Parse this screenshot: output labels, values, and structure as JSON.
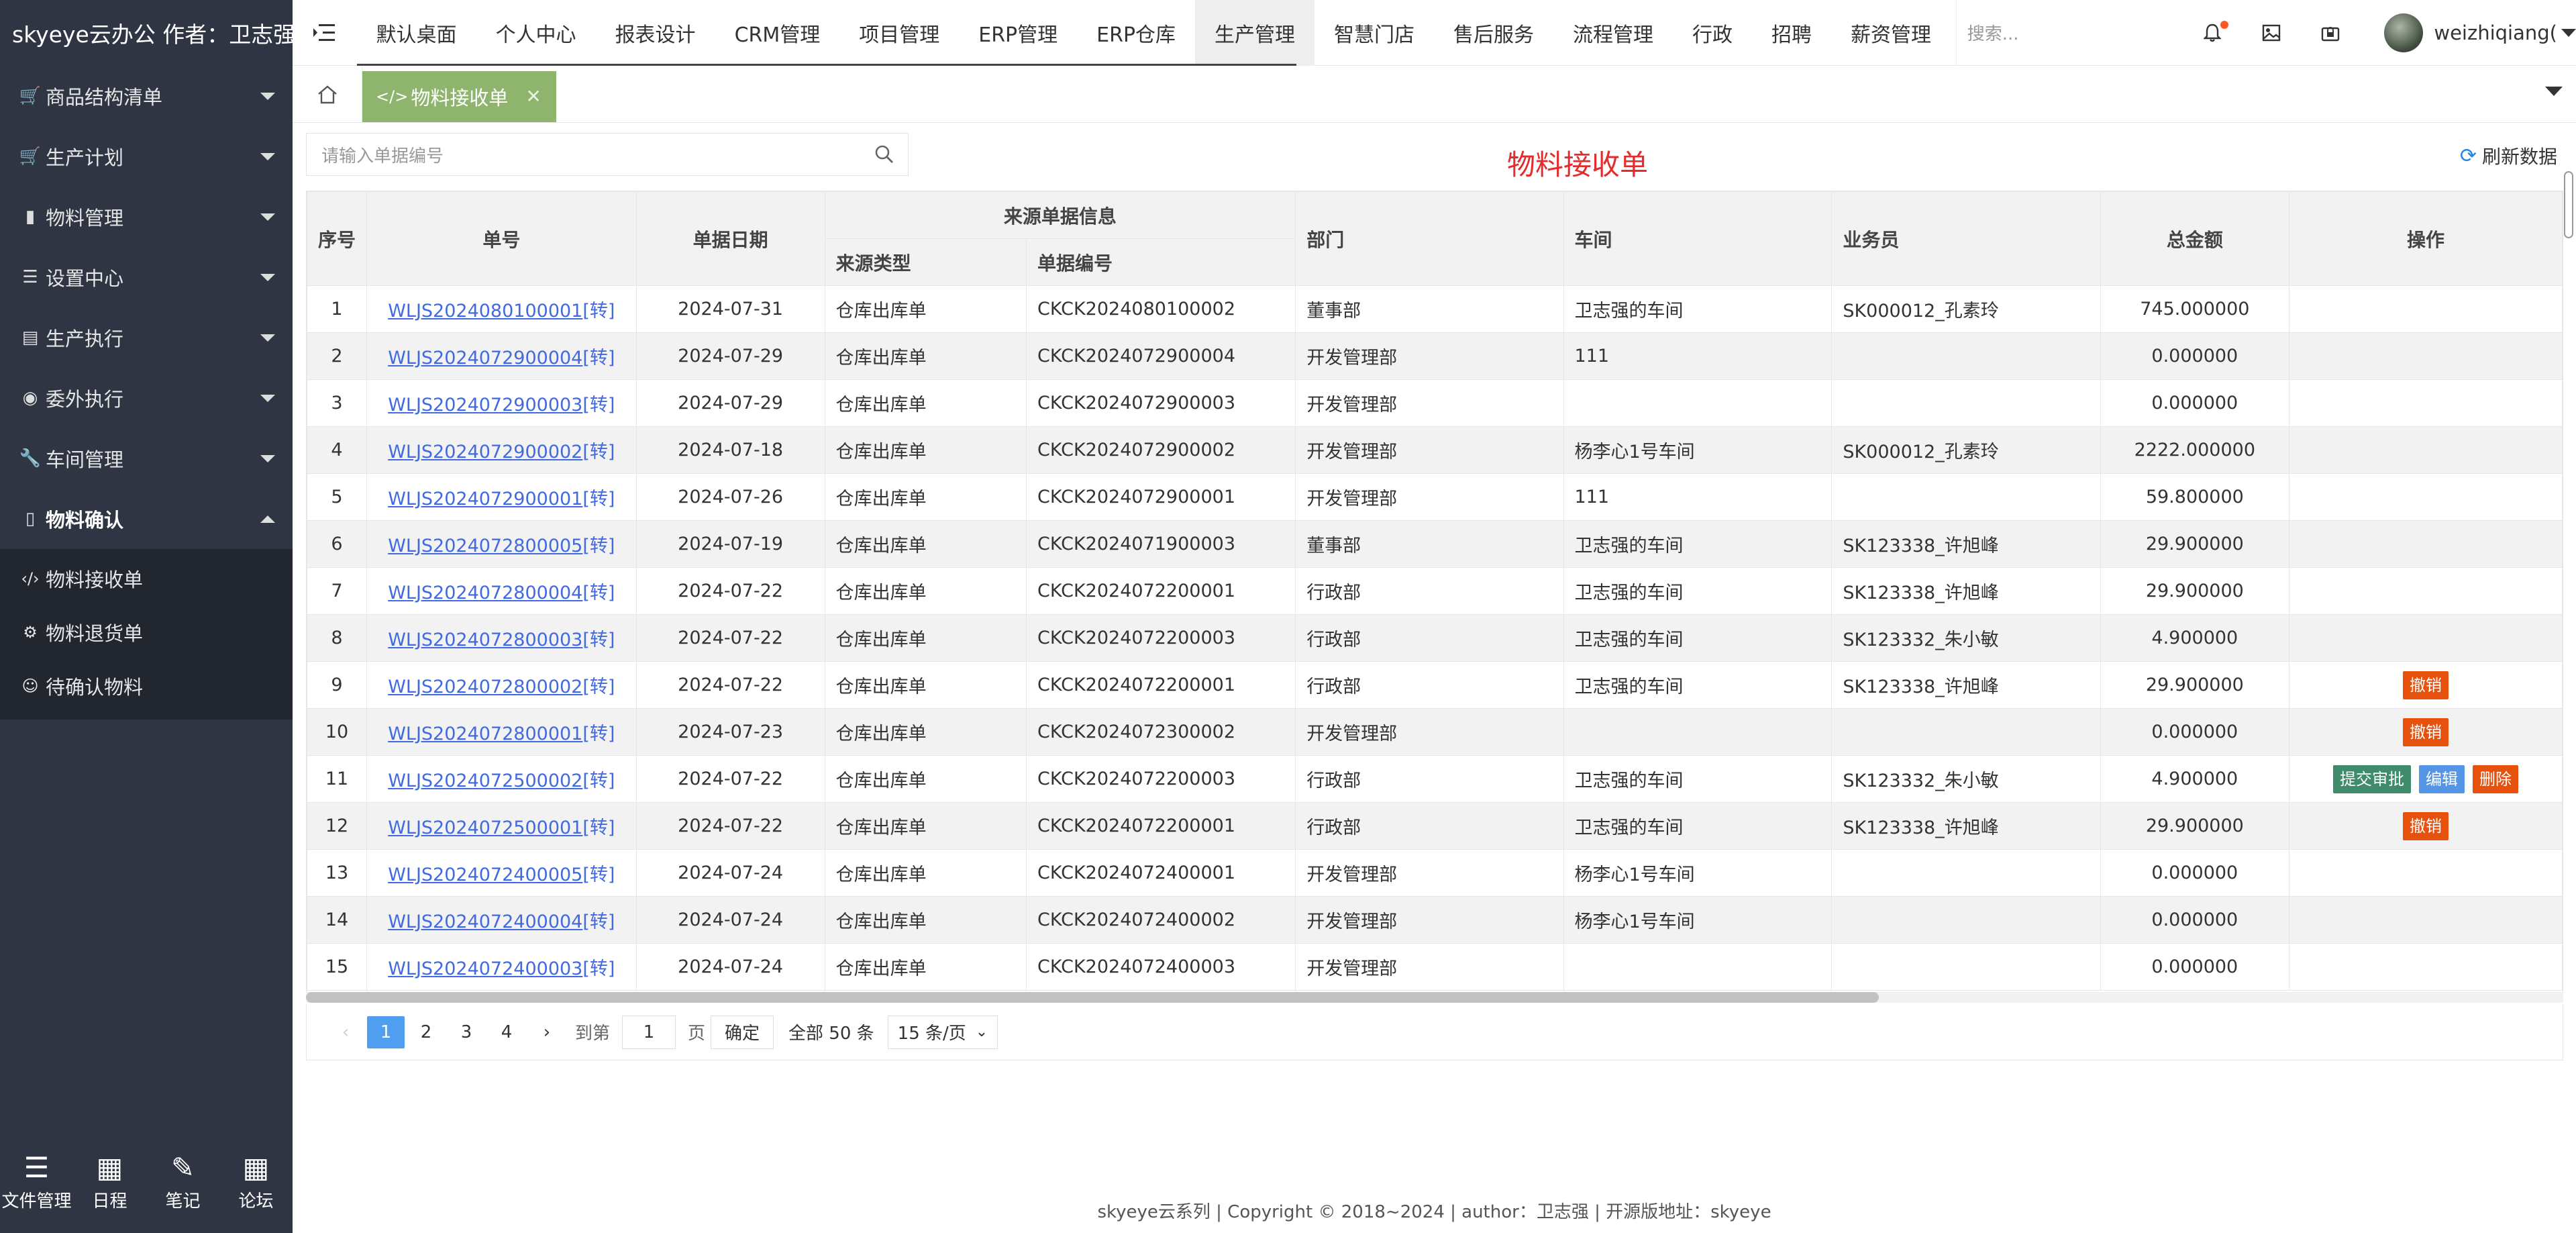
{
  "brand": "skyeye云办公 作者：卫志强",
  "sidebar": {
    "items": [
      {
        "label": "商品结构清单",
        "icon": "cart-icon"
      },
      {
        "label": "生产计划",
        "icon": "cart-icon"
      },
      {
        "label": "物料管理",
        "icon": "folder-icon"
      },
      {
        "label": "设置中心",
        "icon": "sliders-icon"
      },
      {
        "label": "生产执行",
        "icon": "trash-icon"
      },
      {
        "label": "委外执行",
        "icon": "target-icon"
      },
      {
        "label": "车间管理",
        "icon": "wrench-icon"
      },
      {
        "label": "物料确认",
        "icon": "copy-icon"
      }
    ],
    "sub_items": [
      {
        "label": "物料接收单",
        "icon": "code-icon"
      },
      {
        "label": "物料退货单",
        "icon": "gear-icon"
      },
      {
        "label": "待确认物料",
        "icon": "smile-icon"
      }
    ],
    "bottom": [
      {
        "label": "文件管理",
        "icon": "list-icon"
      },
      {
        "label": "日程",
        "icon": "calendar-icon"
      },
      {
        "label": "笔记",
        "icon": "edit-icon"
      },
      {
        "label": "论坛",
        "icon": "calendar-icon"
      }
    ]
  },
  "topnav": {
    "items": [
      "默认桌面",
      "个人中心",
      "报表设计",
      "CRM管理",
      "项目管理",
      "ERP管理",
      "ERP仓库",
      "生产管理",
      "智慧门店",
      "售后服务",
      "流程管理",
      "行政",
      "招聘",
      "薪资管理"
    ],
    "active": "生产管理",
    "search_placeholder": "搜索...",
    "username": "weizhiqiang("
  },
  "tab": {
    "label": "物料接收单"
  },
  "toolbar": {
    "search_placeholder": "请输入单据编号",
    "heading": "物料接收单",
    "refresh_label": "刷新数据"
  },
  "table": {
    "headers": {
      "seq": "序号",
      "no": "单号",
      "date": "单据日期",
      "source_group": "来源单据信息",
      "source_type": "来源类型",
      "source_no": "单据编号",
      "dept": "部门",
      "workshop": "车间",
      "salesman": "业务员",
      "total": "总金额",
      "ops": "操作"
    },
    "rows": [
      {
        "seq": "1",
        "no": "WLJS2024080100001",
        "tag": "[转]",
        "date": "2024-07-31",
        "type": "仓库出库单",
        "src": "CKCK2024080100002",
        "dept": "董事部",
        "ws": "卫志强的车间",
        "sales": "SK000012_孔素玲",
        "total": "745.000000",
        "ops": []
      },
      {
        "seq": "2",
        "no": "WLJS2024072900004",
        "tag": "[转]",
        "date": "2024-07-29",
        "type": "仓库出库单",
        "src": "CKCK2024072900004",
        "dept": "开发管理部",
        "ws": "111",
        "sales": "",
        "total": "0.000000",
        "ops": []
      },
      {
        "seq": "3",
        "no": "WLJS2024072900003",
        "tag": "[转]",
        "date": "2024-07-29",
        "type": "仓库出库单",
        "src": "CKCK2024072900003",
        "dept": "开发管理部",
        "ws": "",
        "sales": "",
        "total": "0.000000",
        "ops": []
      },
      {
        "seq": "4",
        "no": "WLJS2024072900002",
        "tag": "[转]",
        "date": "2024-07-18",
        "type": "仓库出库单",
        "src": "CKCK2024072900002",
        "dept": "开发管理部",
        "ws": "杨李心1号车间",
        "sales": "SK000012_孔素玲",
        "total": "2222.000000",
        "ops": []
      },
      {
        "seq": "5",
        "no": "WLJS2024072900001",
        "tag": "[转]",
        "date": "2024-07-26",
        "type": "仓库出库单",
        "src": "CKCK2024072900001",
        "dept": "开发管理部",
        "ws": "111",
        "sales": "",
        "total": "59.800000",
        "ops": []
      },
      {
        "seq": "6",
        "no": "WLJS2024072800005",
        "tag": "[转]",
        "date": "2024-07-19",
        "type": "仓库出库单",
        "src": "CKCK2024071900003",
        "dept": "董事部",
        "ws": "卫志强的车间",
        "sales": "SK123338_许旭峰",
        "total": "29.900000",
        "ops": []
      },
      {
        "seq": "7",
        "no": "WLJS2024072800004",
        "tag": "[转]",
        "date": "2024-07-22",
        "type": "仓库出库单",
        "src": "CKCK2024072200001",
        "dept": "行政部",
        "ws": "卫志强的车间",
        "sales": "SK123338_许旭峰",
        "total": "29.900000",
        "ops": []
      },
      {
        "seq": "8",
        "no": "WLJS2024072800003",
        "tag": "[转]",
        "date": "2024-07-22",
        "type": "仓库出库单",
        "src": "CKCK2024072200003",
        "dept": "行政部",
        "ws": "卫志强的车间",
        "sales": "SK123332_朱小敏",
        "total": "4.900000",
        "ops": []
      },
      {
        "seq": "9",
        "no": "WLJS2024072800002",
        "tag": "[转]",
        "date": "2024-07-22",
        "type": "仓库出库单",
        "src": "CKCK2024072200001",
        "dept": "行政部",
        "ws": "卫志强的车间",
        "sales": "SK123338_许旭峰",
        "total": "29.900000",
        "ops": [
          {
            "label": "撤销",
            "color": "red"
          }
        ]
      },
      {
        "seq": "10",
        "no": "WLJS2024072800001",
        "tag": "[转]",
        "date": "2024-07-23",
        "type": "仓库出库单",
        "src": "CKCK2024072300002",
        "dept": "开发管理部",
        "ws": "",
        "sales": "",
        "total": "0.000000",
        "ops": [
          {
            "label": "撤销",
            "color": "red"
          }
        ]
      },
      {
        "seq": "11",
        "no": "WLJS2024072500002",
        "tag": "[转]",
        "date": "2024-07-22",
        "type": "仓库出库单",
        "src": "CKCK2024072200003",
        "dept": "行政部",
        "ws": "卫志强的车间",
        "sales": "SK123332_朱小敏",
        "total": "4.900000",
        "ops": [
          {
            "label": "提交审批",
            "color": "green"
          },
          {
            "label": "编辑",
            "color": "blue"
          },
          {
            "label": "删除",
            "color": "red"
          }
        ]
      },
      {
        "seq": "12",
        "no": "WLJS2024072500001",
        "tag": "[转]",
        "date": "2024-07-22",
        "type": "仓库出库单",
        "src": "CKCK2024072200001",
        "dept": "行政部",
        "ws": "卫志强的车间",
        "sales": "SK123338_许旭峰",
        "total": "29.900000",
        "ops": [
          {
            "label": "撤销",
            "color": "red"
          }
        ]
      },
      {
        "seq": "13",
        "no": "WLJS2024072400005",
        "tag": "[转]",
        "date": "2024-07-24",
        "type": "仓库出库单",
        "src": "CKCK2024072400001",
        "dept": "开发管理部",
        "ws": "杨李心1号车间",
        "sales": "",
        "total": "0.000000",
        "ops": []
      },
      {
        "seq": "14",
        "no": "WLJS2024072400004",
        "tag": "[转]",
        "date": "2024-07-24",
        "type": "仓库出库单",
        "src": "CKCK2024072400002",
        "dept": "开发管理部",
        "ws": "杨李心1号车间",
        "sales": "",
        "total": "0.000000",
        "ops": []
      },
      {
        "seq": "15",
        "no": "WLJS2024072400003",
        "tag": "[转]",
        "date": "2024-07-24",
        "type": "仓库出库单",
        "src": "CKCK2024072400003",
        "dept": "开发管理部",
        "ws": "",
        "sales": "",
        "total": "0.000000",
        "ops": []
      }
    ]
  },
  "pager": {
    "pages": [
      "1",
      "2",
      "3",
      "4"
    ],
    "current": "1",
    "goto_label": "到第",
    "goto_value": "1",
    "page_unit": "页",
    "confirm": "确定",
    "total": "全部 50 条",
    "page_size": "15 条/页"
  },
  "footer": "skyeye云系列 | Copyright © 2018~2024 | author：卫志强 | 开源版地址：skyeye",
  "colors": {
    "accent_tab": "#8fb46e",
    "heading": "#e52b2b",
    "pager_current": "#4f9ef0",
    "btn_red": "#e6520e",
    "btn_green": "#3f8b6b",
    "btn_blue": "#5595e6"
  }
}
